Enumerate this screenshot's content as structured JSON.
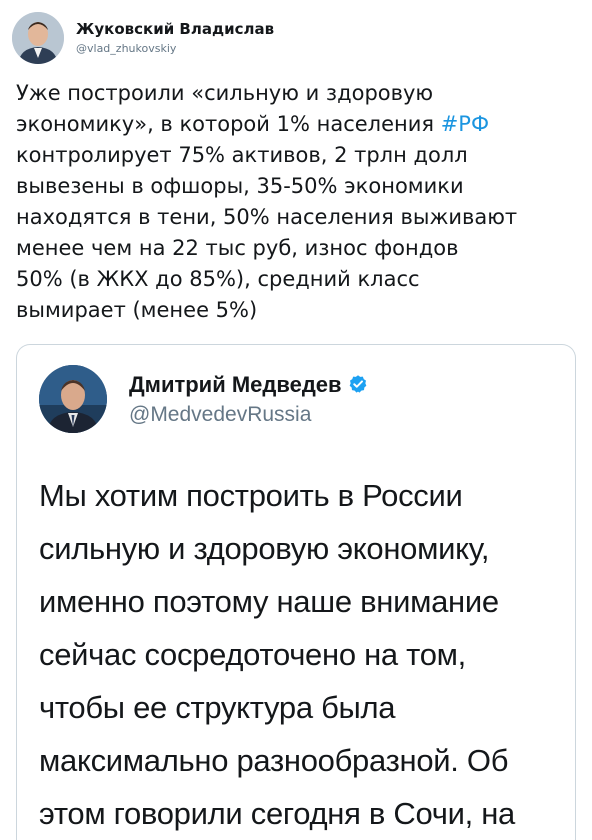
{
  "tweet": {
    "author_name": "Жуковский Владислав",
    "author_handle": "@vlad_zhukovskiy",
    "text_before_hashtag": "Уже построили «сильную и здоровую\nэкономику», в которой 1% населения ",
    "hashtag": "#РФ",
    "text_after_hashtag": "\nконтролирует 75% активов, 2 трлн долл\nвывезены в офшоры, 35-50% экономики\nнаходятся в тени, 50% населения выживают\nменее чем на 22 тыс руб, износ фондов\n50% (в ЖКХ до 85%), средний класс\nвымирает (менее 5%)"
  },
  "quoted_tweet": {
    "author_name": "Дмитрий Медведев",
    "author_handle": "@MedvedevRussia",
    "verified": true,
    "text": "Мы хотим построить в России\nсильную и здоровую экономику,\nименно поэтому наше внимание\nсейчас сосредоточено на том,\nчтобы ее структура была\nмаксимально разнообразной. Об\nэтом говорили сегодня в Сочи, на"
  },
  "colors": {
    "text": "#14171a",
    "secondary": "#657786",
    "hashtag": "#1b95e0",
    "verified_badge": "#1da1f2",
    "card_border": "#ccd6dd"
  },
  "icons": {
    "verified": "verified-badge-icon"
  }
}
